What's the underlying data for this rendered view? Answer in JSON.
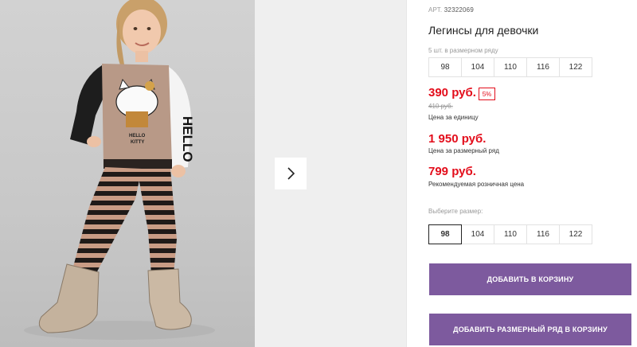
{
  "product": {
    "sku_label": "АРТ.",
    "sku": "32322069",
    "title": "Легинсы для девочки"
  },
  "size_range": {
    "label": "5 шт. в размерном ряду",
    "sizes": [
      "98",
      "104",
      "110",
      "116",
      "122"
    ]
  },
  "prices": {
    "unit_price": "390 руб.",
    "discount": "5%",
    "old_price": "410 руб.",
    "unit_label": "Цена за единицу",
    "range_price": "1 950 руб.",
    "range_label": "Цена за размерный ряд",
    "retail_price": "799 руб.",
    "retail_label": "Рекомендуемая розничная цена"
  },
  "size_select": {
    "label": "Выберите размер:",
    "options": [
      "98",
      "104",
      "110",
      "116",
      "122"
    ],
    "selected": "98"
  },
  "buttons": {
    "add_to_cart": "ДОБАВИТЬ В КОРЗИНУ",
    "add_range_to_cart": "ДОБАВИТЬ РАЗМЕРНЫЙ РЯД В КОРЗИНУ"
  },
  "gallery": {
    "print_text_1": "HELLO",
    "print_text_2": "KITTY",
    "sleeve_text": "HELLO"
  },
  "colors": {
    "price_red": "#e30d1b",
    "button_purple": "#7d5a9e"
  },
  "icons": {
    "next": "chevron-right-icon"
  }
}
